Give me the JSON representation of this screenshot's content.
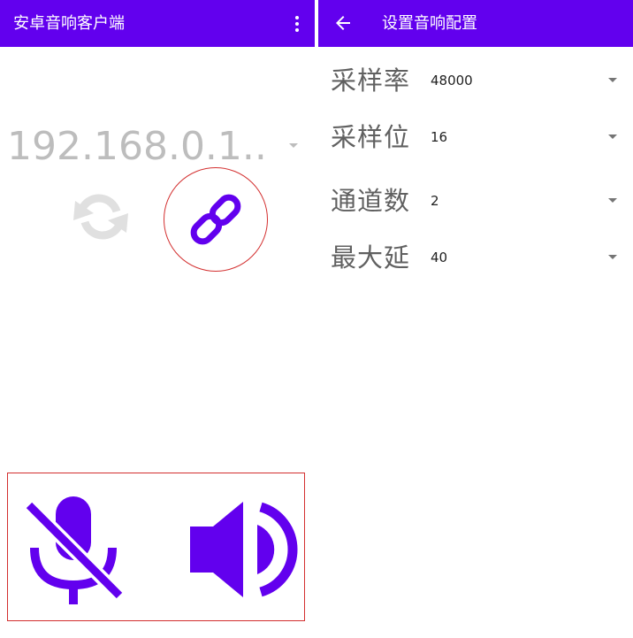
{
  "left_panel": {
    "app_title": "安卓音响客户端",
    "ip_dropdown": {
      "selected": "192.168.0.1.."
    }
  },
  "right_panel": {
    "title": "设置音响配置",
    "settings": [
      {
        "label": "采样率",
        "value": "48000"
      },
      {
        "label": "采样位数",
        "value": "16"
      },
      {
        "label": "通道数",
        "value": "2"
      },
      {
        "label": "最大延迟",
        "value": "40"
      }
    ]
  },
  "icons": {
    "overflow": "more-vert-icon",
    "back": "arrow-back-icon",
    "refresh": "refresh-icon",
    "link": "link-icon",
    "mic_off": "mic-off-icon",
    "speaker": "volume-icon"
  },
  "colors": {
    "primary": "#6200ee",
    "accent_border": "#d32f2f",
    "disabled_icon": "#e0e0e0",
    "hint_text": "#bdbdbd"
  }
}
